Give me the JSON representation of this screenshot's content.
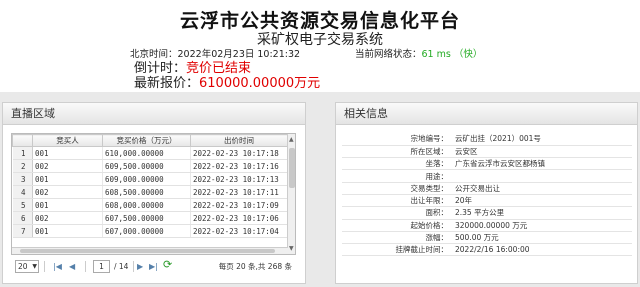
{
  "header": {
    "title": "云浮市公共资源交易信息化平台",
    "subtitle": "采矿权电子交易系统",
    "time_label": "北京时间：",
    "time_value": "2022年02月23日  10:21:32",
    "net_label": "当前网络状态：",
    "net_value": "61 ms （快）",
    "countdown_label": "倒计时：",
    "countdown_value": "竞价已结束",
    "latest_label": "最新报价：",
    "latest_value": "610000.00000万元"
  },
  "live_panel": {
    "title": "直播区域",
    "columns": [
      "竞买人",
      "竞买价格（万元）",
      "出价时间"
    ],
    "rows": [
      {
        "n": "1",
        "bidder": "001",
        "price": "610,000.00000",
        "time": "2022-02-23 10:17:18"
      },
      {
        "n": "2",
        "bidder": "002",
        "price": "609,500.00000",
        "time": "2022-02-23 10:17:16"
      },
      {
        "n": "3",
        "bidder": "001",
        "price": "609,000.00000",
        "time": "2022-02-23 10:17:13"
      },
      {
        "n": "4",
        "bidder": "002",
        "price": "608,500.00000",
        "time": "2022-02-23 10:17:11"
      },
      {
        "n": "5",
        "bidder": "001",
        "price": "608,000.00000",
        "time": "2022-02-23 10:17:09"
      },
      {
        "n": "6",
        "bidder": "002",
        "price": "607,500.00000",
        "time": "2022-02-23 10:17:06"
      },
      {
        "n": "7",
        "bidder": "001",
        "price": "607,000.00000",
        "time": "2022-02-23 10:17:04"
      }
    ],
    "pager": {
      "page_size": "20",
      "page": "1",
      "total_pages": "/ 14",
      "summary": "每页 20 条,共 268 条"
    }
  },
  "info_panel": {
    "title": "相关信息",
    "fields": [
      {
        "k": "宗地编号：",
        "v": "云矿出挂（2021）001号"
      },
      {
        "k": "所在区域：",
        "v": "云安区"
      },
      {
        "k": "坐落：",
        "v": "广东省云浮市云安区都杨镇"
      },
      {
        "k": "用途：",
        "v": ""
      },
      {
        "k": "交易类型：",
        "v": "公开交易出让"
      },
      {
        "k": "出让年限：",
        "v": "20年"
      },
      {
        "k": "面积：",
        "v": "2.35 平方公里"
      },
      {
        "k": "起始价格：",
        "v": "320000.00000 万元"
      },
      {
        "k": "涨幅：",
        "v": "500.00 万元"
      },
      {
        "k": "挂牌截止时间：",
        "v": "2022/2/16 16:00:00"
      }
    ]
  },
  "icons": {
    "first": "first-page-icon",
    "prev": "prev-page-icon",
    "next": "next-page-icon",
    "last": "last-page-icon",
    "refresh": "refresh-icon"
  },
  "colors": {
    "alert": "#e00000",
    "network_ok": "#22aa22"
  }
}
